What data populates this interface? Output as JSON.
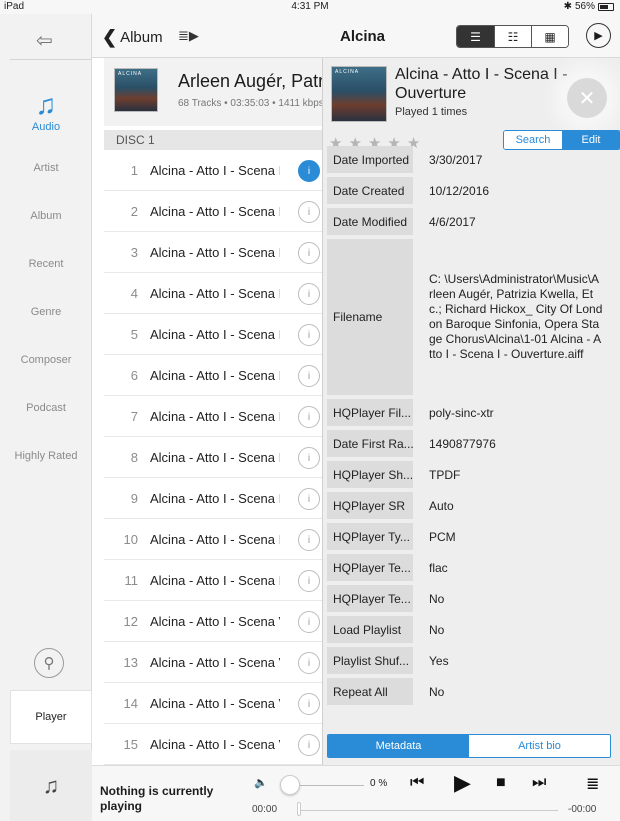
{
  "status": {
    "device": "iPad",
    "time": "4:31 PM",
    "battery": "56%"
  },
  "nav": {
    "back_label": "Album",
    "title": "Alcina"
  },
  "sidebar": {
    "items": [
      "Audio",
      "Artist",
      "Album",
      "Recent",
      "Genre",
      "Composer",
      "Podcast",
      "Highly Rated"
    ],
    "player_label": "Player"
  },
  "album": {
    "artist": "Arleen Augér, Patrizia Kwella, Etc.",
    "meta": "68 Tracks • 03:35:03 • 1411 kbps",
    "art_label": "ALCINA",
    "disc": "DISC 1"
  },
  "tracks": [
    {
      "num": "1",
      "title": "Alcina - Atto I - Scena I - Ouverture"
    },
    {
      "num": "2",
      "title": "Alcina - Atto I - Scena I - Ouverture"
    },
    {
      "num": "3",
      "title": "Alcina - Atto I - Scena I - Ouverture"
    },
    {
      "num": "4",
      "title": "Alcina - Atto I - Scena I - Ouverture"
    },
    {
      "num": "5",
      "title": "Alcina - Atto I - Scena I - Ouverture"
    },
    {
      "num": "6",
      "title": "Alcina - Atto I - Scena I - Ouverture"
    },
    {
      "num": "7",
      "title": "Alcina - Atto I - Scena I - Ouverture"
    },
    {
      "num": "8",
      "title": "Alcina - Atto I - Scena I - Ouverture"
    },
    {
      "num": "9",
      "title": "Alcina - Atto I - Scena I - Ouverture"
    },
    {
      "num": "10",
      "title": "Alcina - Atto I - Scena I'"
    },
    {
      "num": "11",
      "title": "Alcina - Atto I - Scena I'"
    },
    {
      "num": "12",
      "title": "Alcina - Atto I - Scena V"
    },
    {
      "num": "13",
      "title": "Alcina - Atto I - Scena V"
    },
    {
      "num": "14",
      "title": "Alcina - Atto I - Scena V"
    },
    {
      "num": "15",
      "title": "Alcina - Atto I - Scena V"
    }
  ],
  "panel": {
    "title": "Alcina - Atto I - Scena I - Ouverture",
    "played": "Played 1 times",
    "rating": 0,
    "buttons": {
      "search": "Search",
      "edit": "Edit"
    },
    "rows": [
      {
        "key": "Date Imported",
        "value": "3/30/2017"
      },
      {
        "key": "Date Created",
        "value": "10/12/2016"
      },
      {
        "key": "Date Modified",
        "value": "4/6/2017"
      },
      {
        "key": "Filename",
        "value": "C: \\Users\\Administrator\\Music\\Arleen Augér, Patrizia Kwella, Etc.; Richard Hickox_ City Of London Baroque Sinfonia, Opera Stage Chorus\\Alcina\\1-01 Alcina - Atto I - Scena I - Ouverture.aiff"
      },
      {
        "key": "HQPlayer Fil...",
        "value": "poly-sinc-xtr"
      },
      {
        "key": "Date First Ra...",
        "value": "1490877976"
      },
      {
        "key": "HQPlayer Sh...",
        "value": "TPDF"
      },
      {
        "key": "HQPlayer SR",
        "value": "Auto"
      },
      {
        "key": "HQPlayer Ty...",
        "value": "PCM"
      },
      {
        "key": "HQPlayer Te...",
        "value": "flac"
      },
      {
        "key": "HQPlayer Te...",
        "value": "No"
      },
      {
        "key": "Load Playlist",
        "value": "No"
      },
      {
        "key": "Playlist Shuf...",
        "value": "Yes"
      },
      {
        "key": "Repeat All",
        "value": "No"
      }
    ],
    "tabs": [
      "Metadata",
      "Artist bio"
    ]
  },
  "player": {
    "now_playing": "Nothing is currently playing",
    "volume_pct": "0 %",
    "time_start": "00:00",
    "time_end": "-00:00"
  }
}
